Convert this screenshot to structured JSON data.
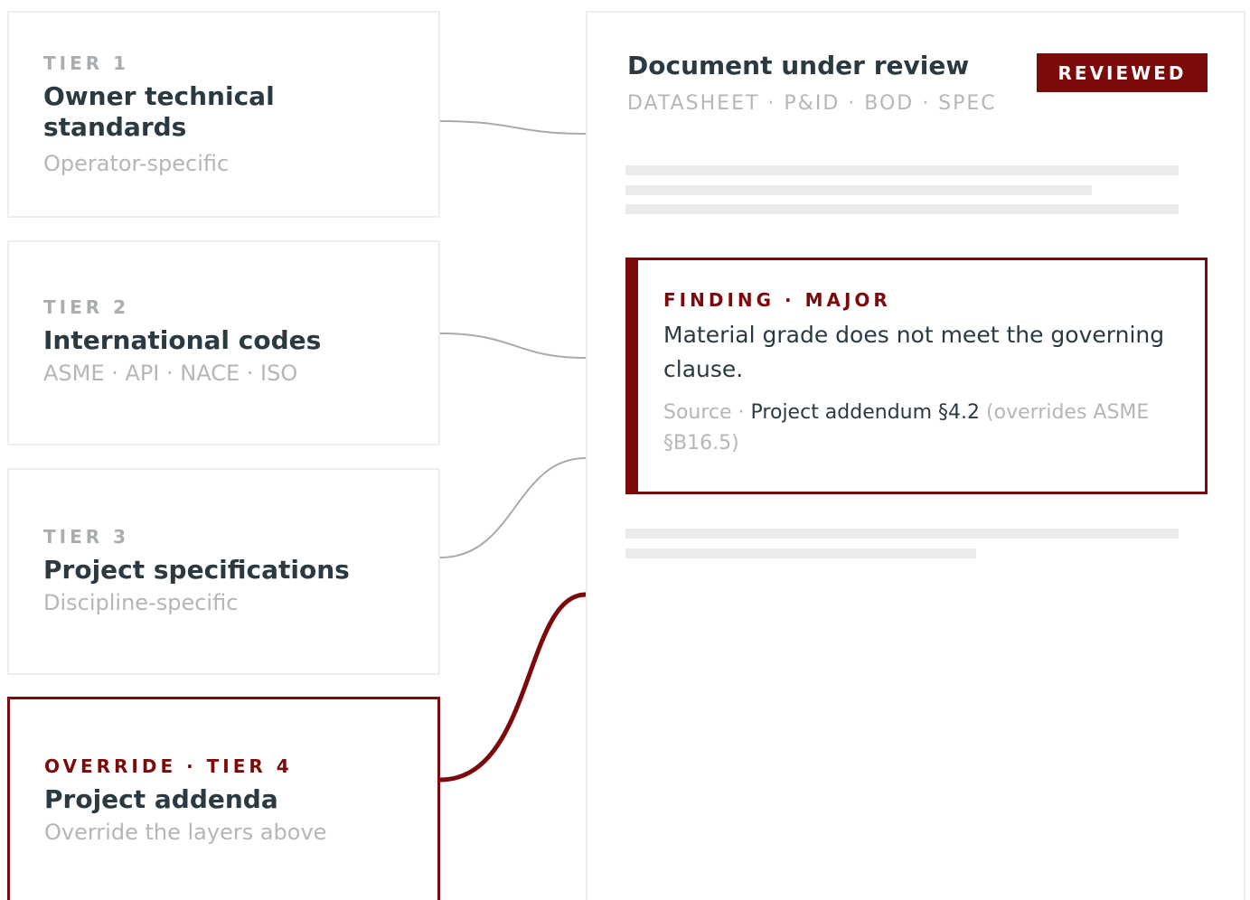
{
  "tiers": [
    {
      "label": "TIER 1",
      "title": "Owner technical standards",
      "subtitle": "Operator-specific"
    },
    {
      "label": "TIER 2",
      "title": "International codes",
      "subtitle": "ASME · API · NACE · ISO"
    },
    {
      "label": "TIER 3",
      "title": "Project specifications",
      "subtitle": "Discipline-specific"
    },
    {
      "label": "OVERRIDE · TIER 4",
      "title": "Project addenda",
      "subtitle": "Override the layers above"
    }
  ],
  "document": {
    "title": "Document under review",
    "types": "DATASHEET · P&ID · BOD · SPEC",
    "badge": "REVIEWED",
    "finding": {
      "label": "FINDING · MAJOR",
      "text": "Material grade does not meet the governing clause.",
      "source_prefix": "Source · ",
      "source_ref": "Project addendum §4.2",
      "source_suffix": " (overrides ASME §B16.5)"
    }
  },
  "colors": {
    "accent": "#7d0a0a",
    "text": "#2b3a42",
    "muted": "#b3b7b9",
    "border": "#eeeeee",
    "connector": "#aaaaaa"
  }
}
